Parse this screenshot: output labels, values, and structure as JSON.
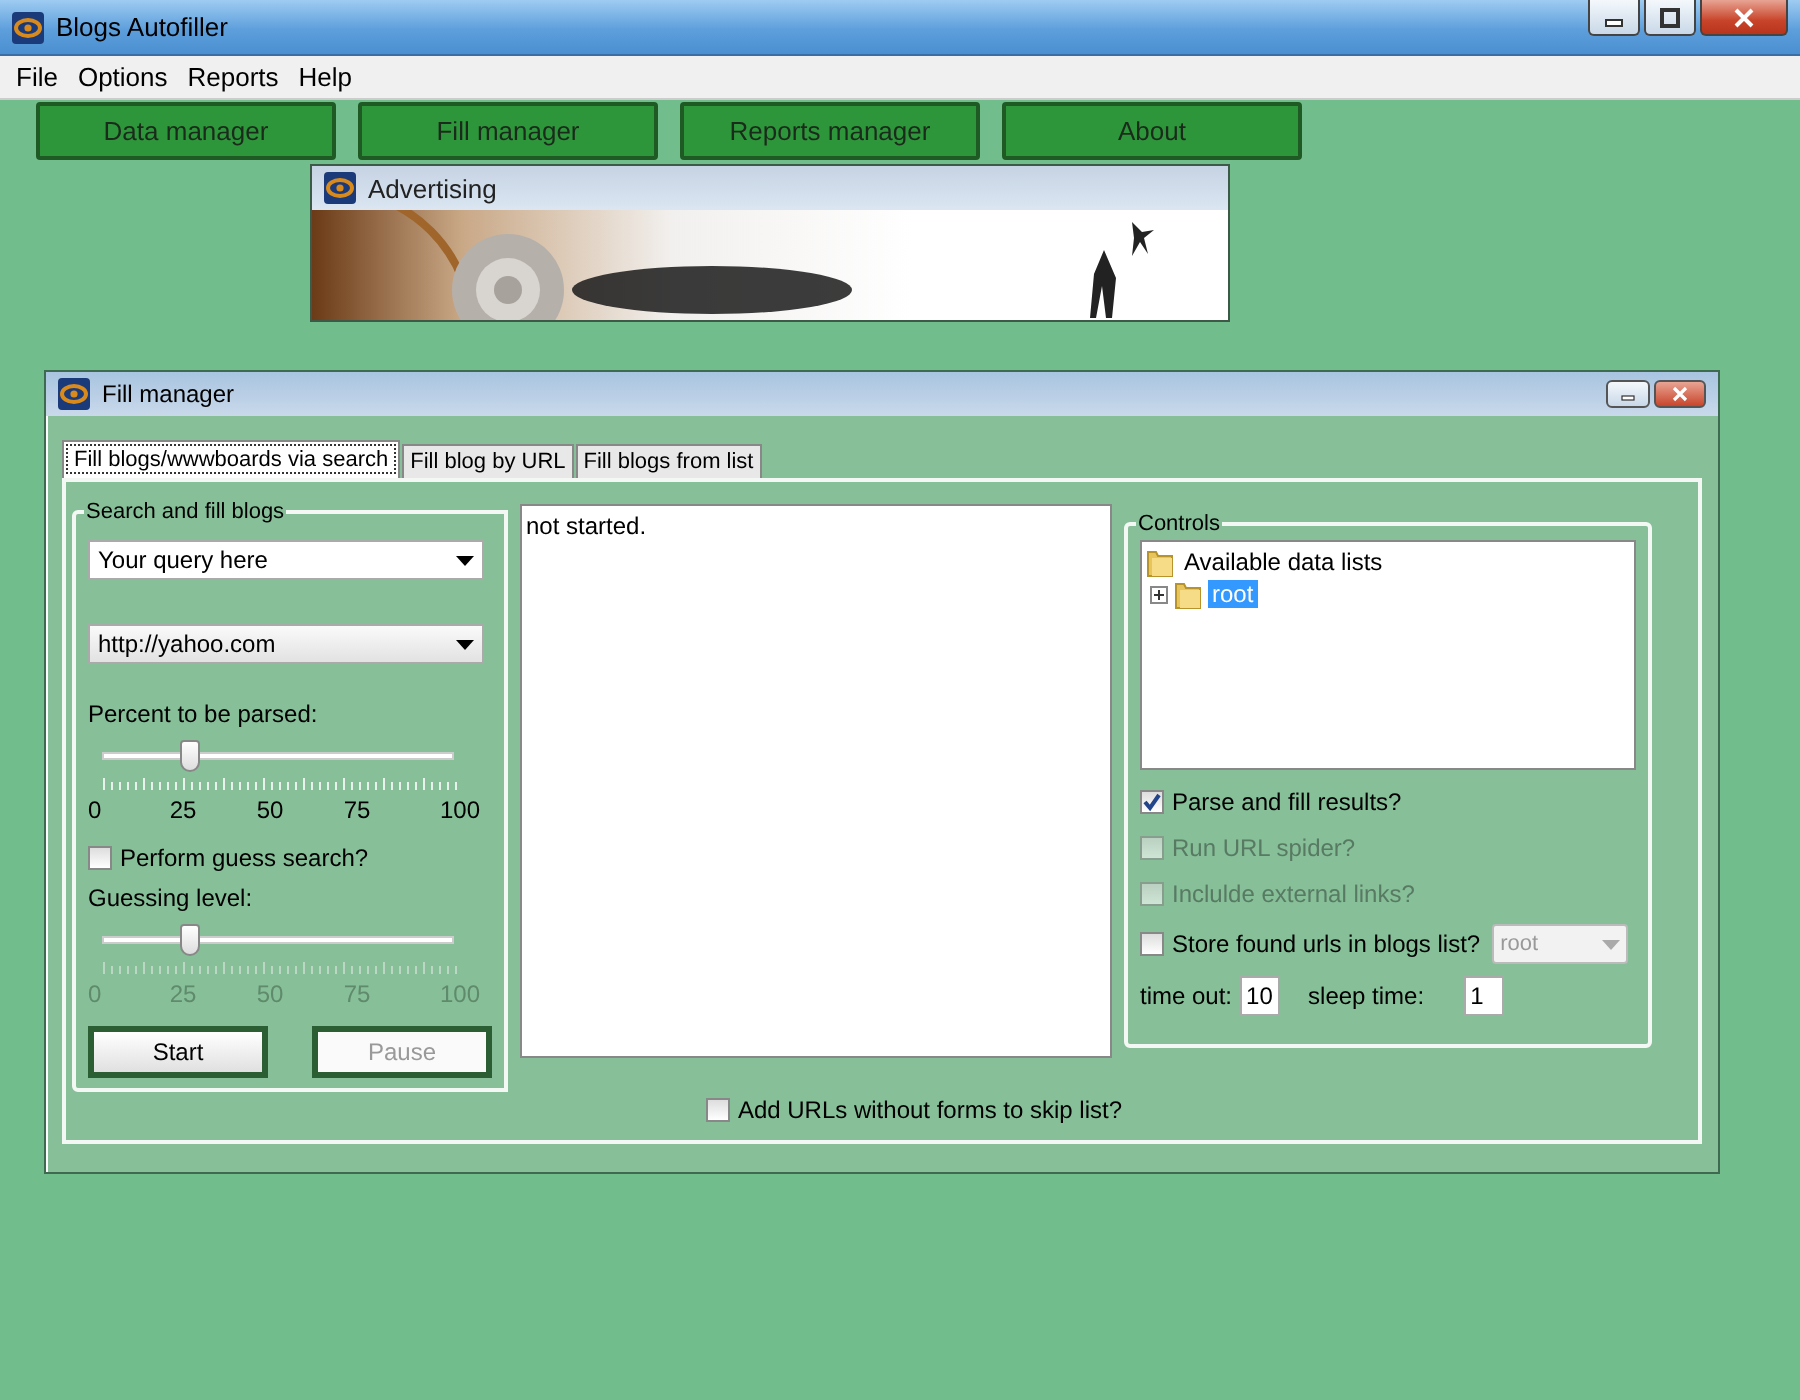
{
  "window": {
    "title": "Blogs Autofiller"
  },
  "menu": [
    "File",
    "Options",
    "Reports",
    "Help"
  ],
  "nav_buttons": [
    {
      "label": "Data manager"
    },
    {
      "label": "Fill manager"
    },
    {
      "label": "Reports manager"
    },
    {
      "label": "About"
    }
  ],
  "advertising": {
    "title": "Advertising",
    "kind": "picture"
  },
  "fill_manager": {
    "title": "Fill manager",
    "tabs": [
      {
        "label": "Fill blogs/wwwboards via search",
        "selected": true
      },
      {
        "label": "Fill blog by URL",
        "selected": false
      },
      {
        "label": "Fill blogs from list",
        "selected": false
      }
    ],
    "search_group": {
      "title": "Search and fill blogs",
      "query": {
        "value": "Your query here"
      },
      "engine": {
        "value": "http://yahoo.com"
      },
      "sliders": [
        {
          "label": "Percent to be parsed:",
          "level": 0.25,
          "ticks": [
            "0",
            "25",
            "50",
            "75",
            "100"
          ],
          "disabled": false
        },
        {
          "label": "Guessing level:",
          "level": 0.25,
          "ticks": [
            "0",
            "25",
            "50",
            "75",
            "100"
          ],
          "disabled": true
        }
      ],
      "guess_search": {
        "label": "Perform guess search?",
        "checked": false
      },
      "buttons": [
        {
          "label": "Start",
          "disabled": false
        },
        {
          "label": "Pause",
          "disabled": true
        }
      ]
    },
    "log": "not started.",
    "skip_list": {
      "label": "Add URLs without forms to skip list?",
      "checked": false
    },
    "controls": {
      "title": "Controls",
      "tree": {
        "label": "Available data lists",
        "expanded": true,
        "selected": false,
        "children": [
          {
            "label": "root",
            "expanded": false,
            "selected": true
          }
        ]
      },
      "options": [
        {
          "label": "Parse and fill results?",
          "checked": true,
          "disabled": false
        },
        {
          "label": "Run URL spider?",
          "checked": false,
          "disabled": true
        },
        {
          "label": "Inclulde external links?",
          "checked": false,
          "disabled": true
        }
      ],
      "store": {
        "label": "Store found urls in blogs list?",
        "checked": false,
        "list": "root",
        "list_disabled": true
      },
      "timeout": {
        "label": "time out:",
        "value": "10"
      },
      "sleep": {
        "label": "sleep time:",
        "value": "1"
      }
    }
  }
}
